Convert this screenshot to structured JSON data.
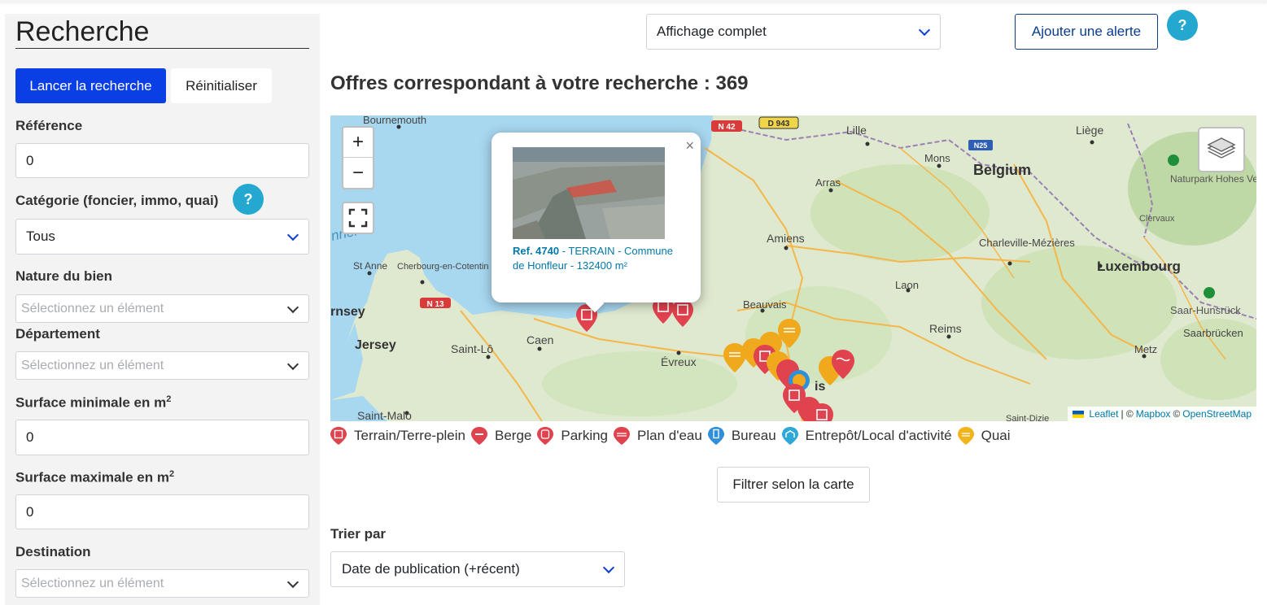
{
  "sidebar": {
    "title": "Recherche",
    "search_button": "Lancer la recherche",
    "reset_button": "Réinitialiser",
    "reference": {
      "label": "Référence",
      "value": "0"
    },
    "category": {
      "label": "Catégorie (foncier, immo, quai)",
      "help": "?",
      "value": "Tous"
    },
    "nature": {
      "label": "Nature du bien",
      "placeholder": "Sélectionnez un élément"
    },
    "department": {
      "label": "Département",
      "placeholder": "Sélectionnez un élément"
    },
    "surface_min": {
      "label": "Surface minimale en m",
      "sup": "2",
      "value": "0"
    },
    "surface_max": {
      "label": "Surface maximale en m",
      "sup": "2",
      "value": "0"
    },
    "destination": {
      "label": "Destination",
      "placeholder": "Sélectionnez un élément"
    }
  },
  "header": {
    "display_select": "Affichage complet",
    "alert_button": "Ajouter une alerte",
    "help": "?",
    "results_title": "Offres correspondant à votre recherche : 369"
  },
  "map": {
    "zoom_in": "+",
    "zoom_out": "−",
    "popup": {
      "close": "×",
      "ref": "Ref. 4740",
      "desc": " - TERRAIN - Commune de Honfleur - 132400 m²"
    },
    "labels": [
      "Bournemouth",
      "Lille",
      "Liège",
      "Mons",
      "Belgium",
      "Arras",
      "Naturpark Hohes Venn-Eifel",
      "Clervaux",
      "Amiens",
      "Charleville-Mézières",
      "Luxembourg",
      "St Anne",
      "Cherbourg-en-Cotentin",
      "Laon",
      "Saar-Hunsrück",
      "rnsey",
      "Beauvais",
      "Reims",
      "Saarbrücken",
      "Jersey",
      "Caen",
      "Saint-Lô",
      "Évreux",
      "Metz",
      "Saint-Malo",
      "Saint-Dizie",
      "nnel",
      "is"
    ],
    "road_labels": [
      "N 42",
      "D 943",
      "N25",
      "N 13"
    ],
    "attribution": {
      "leaflet": "Leaflet",
      "sep": "| ©",
      "mapbox": "Mapbox",
      "copy": "©",
      "osm": "OpenStreetMap"
    },
    "colors": {
      "terrain": "#e0424e",
      "quai": "#f0a81c",
      "entrepot": "#2f8fd8",
      "water": "#a8d7f0"
    }
  },
  "legend": [
    {
      "label": "Terrain/Terre-plein",
      "color": "#e0424e",
      "icon": "terrain-icon"
    },
    {
      "label": "Berge",
      "color": "#e0424e",
      "icon": "berge-icon"
    },
    {
      "label": "Parking",
      "color": "#e0424e",
      "icon": "parking-icon"
    },
    {
      "label": "Plan d'eau",
      "color": "#e0424e",
      "icon": "plan-eau-icon"
    },
    {
      "label": "Bureau",
      "color": "#2f8fd8",
      "icon": "bureau-icon"
    },
    {
      "label": "Entrepôt/Local d'activité",
      "color": "#2fa8d8",
      "icon": "entrepot-icon"
    },
    {
      "label": "Quai",
      "color": "#f0b51c",
      "icon": "quai-icon"
    }
  ],
  "filter_button": "Filtrer selon la carte",
  "sort": {
    "label": "Trier par",
    "value": "Date de publication (+récent)"
  }
}
